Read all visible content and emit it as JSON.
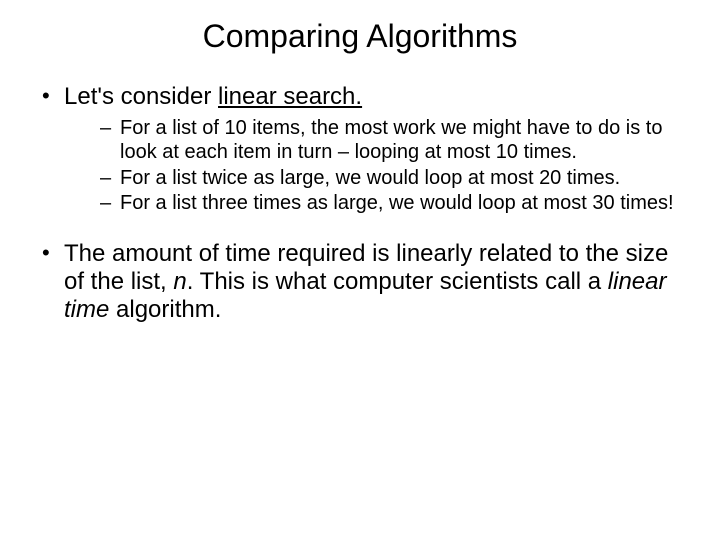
{
  "title": "Comparing Algorithms",
  "b1_pre": "Let's consider ",
  "b1_u": "linear search.",
  "s1": "For a list of 10 items, the most work we might have to do is to look at each item in turn – looping at most 10 times.",
  "s2": "For a list twice as large, we would loop at most 20 times.",
  "s3": "For a list three times as large, we would loop at most 30 times!",
  "b2_a": "The amount of time required is linearly related to the size of the list, ",
  "b2_n": "n",
  "b2_b": ". This is what computer scientists call a ",
  "b2_lt": "linear time",
  "b2_c": " algorithm."
}
